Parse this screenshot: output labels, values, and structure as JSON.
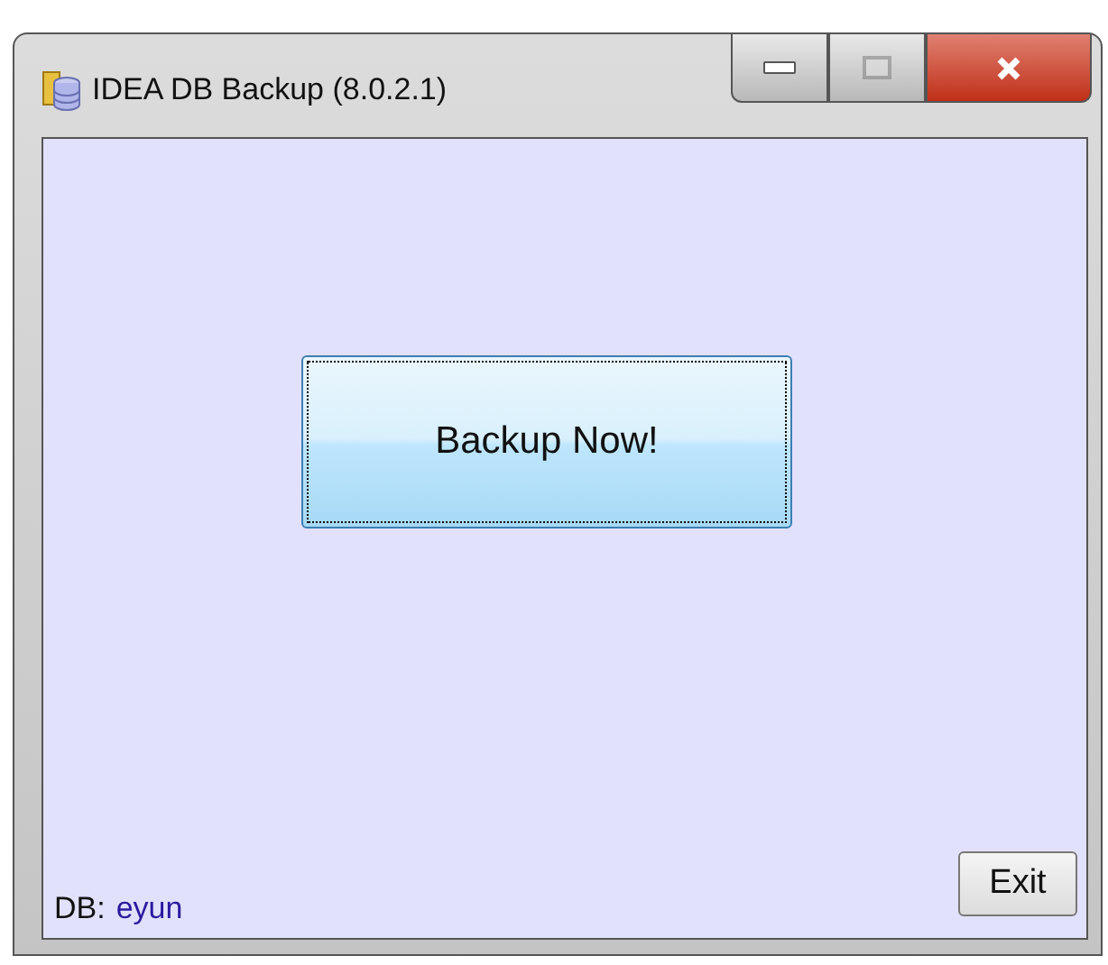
{
  "window": {
    "title": "IDEA DB Backup (8.0.2.1)",
    "maximize_disabled": true
  },
  "main_button": {
    "label": "Backup Now!",
    "focused": true
  },
  "exit_button": {
    "label": "Exit"
  },
  "status": {
    "label": "DB:",
    "value": "eyun"
  }
}
